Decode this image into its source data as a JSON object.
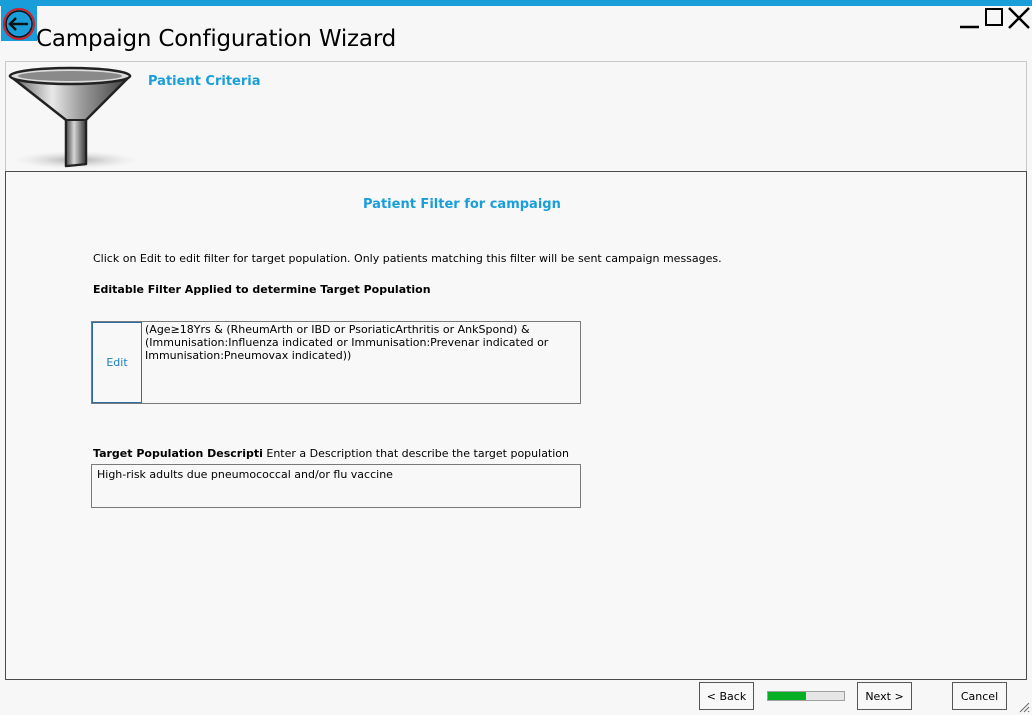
{
  "window": {
    "title": "Campaign Configuration Wizard",
    "accent_color": "#1a9ed9",
    "controls": [
      "minimize-icon",
      "maximize-icon",
      "close-icon"
    ]
  },
  "back_button": {
    "icon": "back-arrow-icon"
  },
  "header": {
    "icon": "funnel-icon",
    "section_title": "Patient Criteria"
  },
  "content": {
    "heading": "Patient Filter for campaign",
    "instruction": "Click on Edit to edit filter for target population. Only patients matching this filter will be sent campaign messages.",
    "filter_label": "Editable Filter Applied to determine Target Population",
    "edit_label": "Edit",
    "filter_text": "(Age≥18Yrs & (RheumArth or IBD or PsoriaticArthritis or AnkSpond) & (Immunisation:Influenza indicated or Immunisation:Prevenar indicated or Immunisation:Pneumovax indicated))",
    "desc_label": "Target Population Descripti",
    "desc_hint": " Enter a Description that describe the target population",
    "desc_value": "High-risk adults due pneumococcal and/or flu vaccine"
  },
  "footer": {
    "back_label": "< Back",
    "next_label": "Next >",
    "cancel_label": "Cancel",
    "progress_fraction": 0.5,
    "progress_color": "#06b025"
  }
}
